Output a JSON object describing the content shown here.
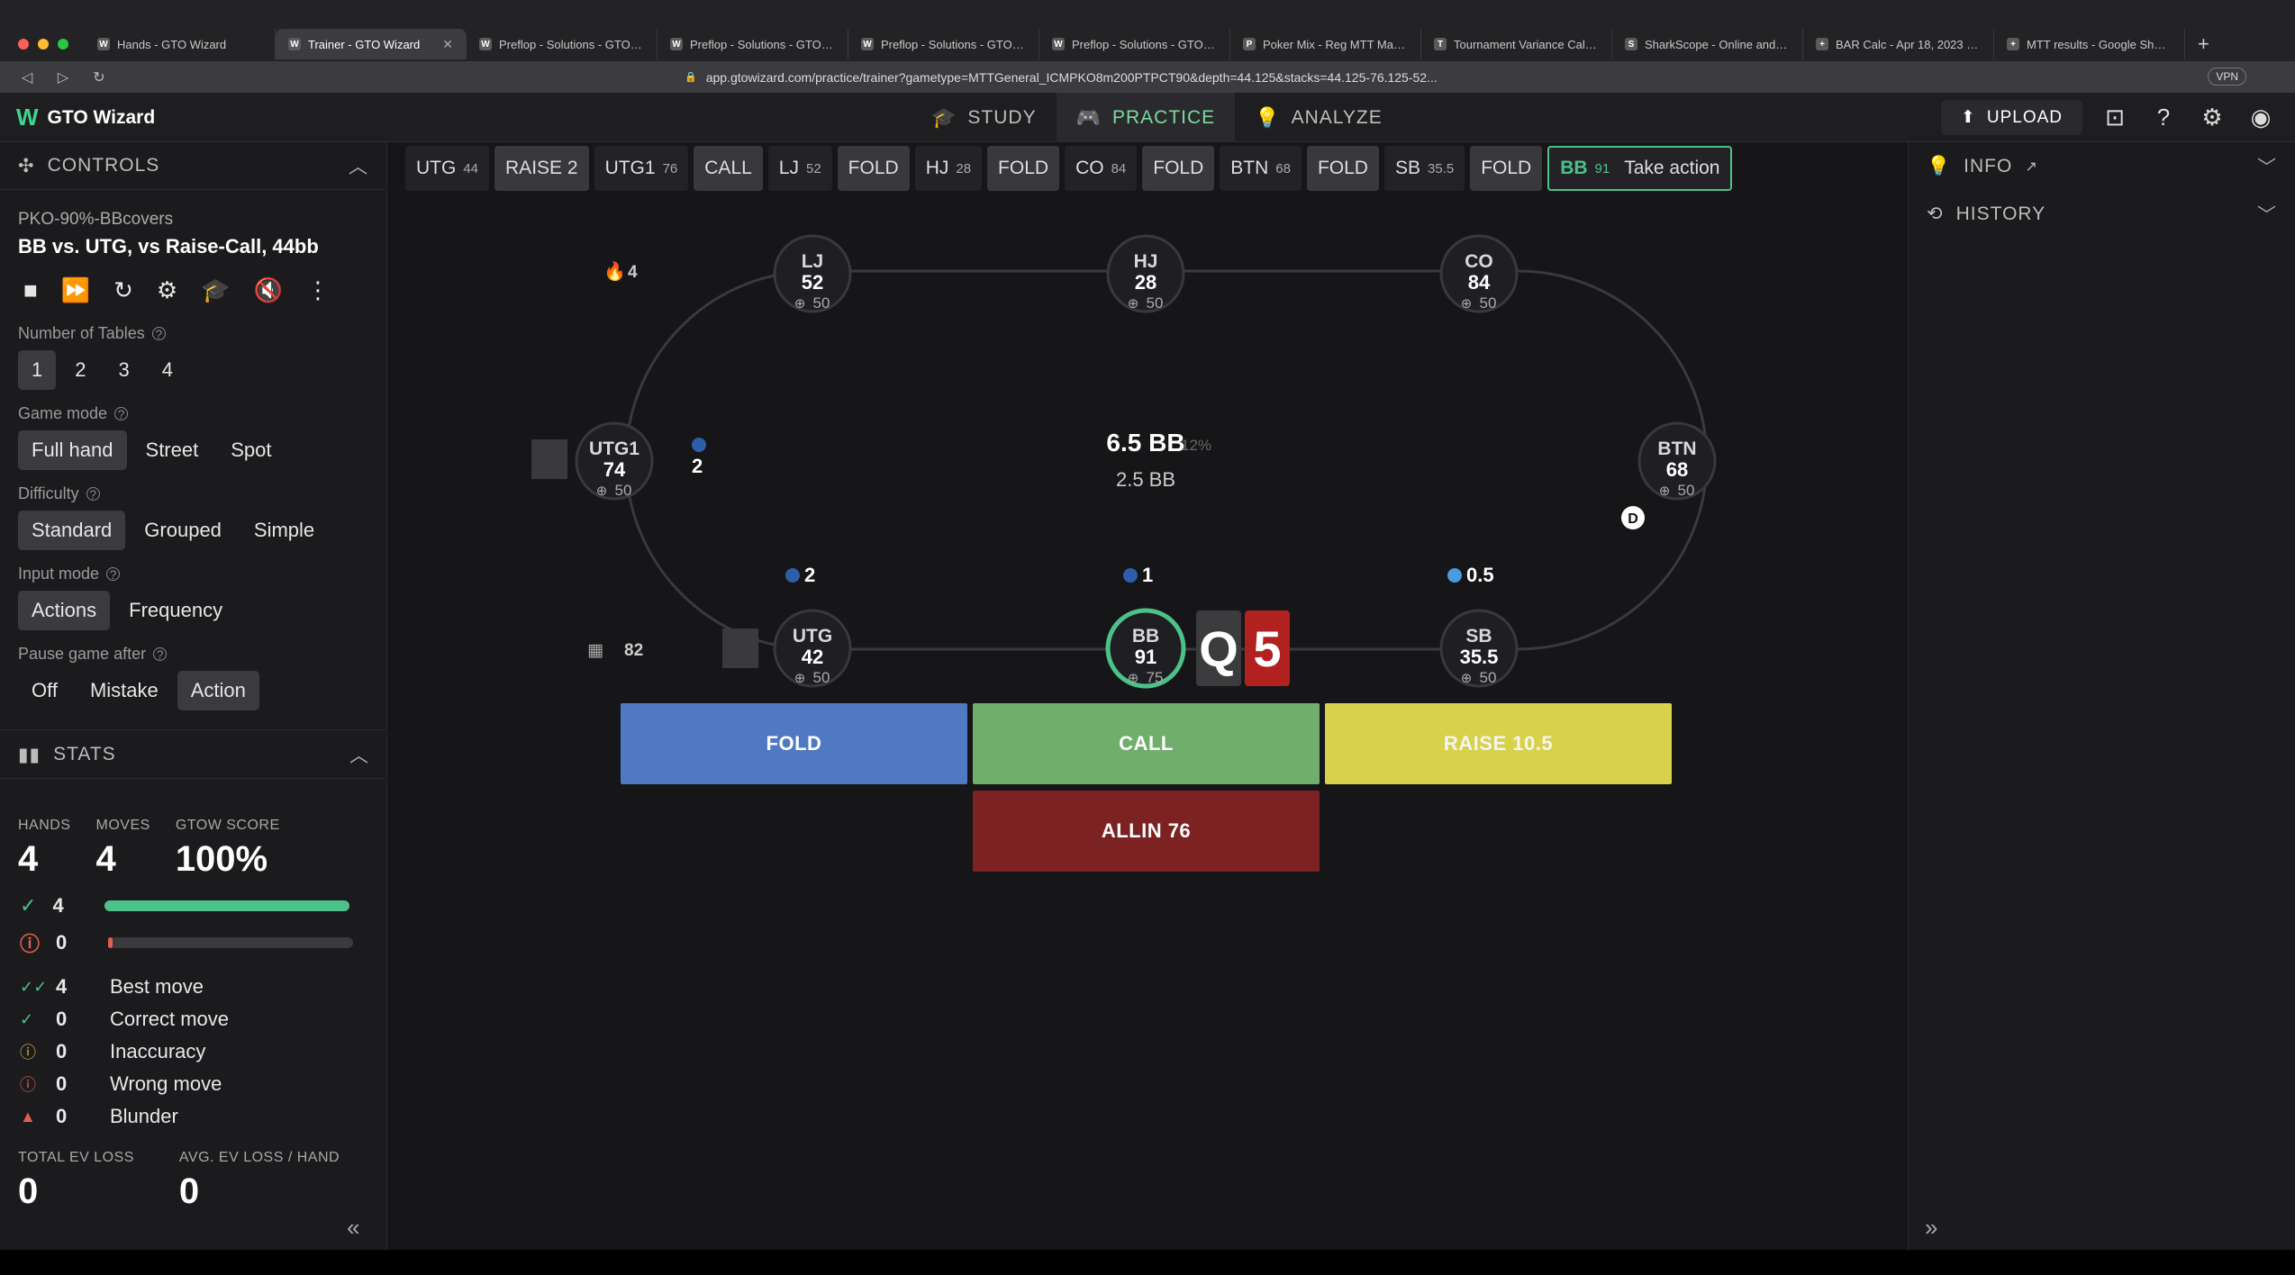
{
  "browser": {
    "tabs": [
      {
        "label": "Hands - GTO Wizard",
        "icon": "W"
      },
      {
        "label": "Trainer - GTO Wizard",
        "icon": "W",
        "active": true
      },
      {
        "label": "Preflop - Solutions - GTO Wi...",
        "icon": "W"
      },
      {
        "label": "Preflop - Solutions - GTO Wi...",
        "icon": "W"
      },
      {
        "label": "Preflop - Solutions - GTO Wi...",
        "icon": "W"
      },
      {
        "label": "Preflop - Solutions - GTO Wi...",
        "icon": "W"
      },
      {
        "label": "Poker Mix - Reg MTT Map, O...",
        "icon": "P"
      },
      {
        "label": "Tournament Variance Calcula...",
        "icon": "T"
      },
      {
        "label": "SharkScope - Online and Live...",
        "icon": "S"
      },
      {
        "label": "BAR Calc - Apr 18, 2023 - Go...",
        "icon": "+"
      },
      {
        "label": "MTT results - Google Sheets",
        "icon": "+"
      }
    ],
    "url": "app.gtowizard.com/practice/trainer?gametype=MTTGeneral_ICMPKO8m200PTPCT90&depth=44.125&stacks=44.125-76.125-52...",
    "vpn": "VPN"
  },
  "app": {
    "logo": "GTO Wizard",
    "nav": {
      "study": "STUDY",
      "practice": "PRACTICE",
      "analyze": "ANALYZE"
    },
    "upload": "UPLOAD"
  },
  "controls": {
    "header": "CONTROLS",
    "sub": "PKO-90%-BBcovers",
    "title": "BB vs. UTG, vs Raise-Call, 44bb",
    "tables_label": "Number of Tables",
    "tables": [
      "1",
      "2",
      "3",
      "4"
    ],
    "game_mode_label": "Game mode",
    "game_modes": [
      "Full hand",
      "Street",
      "Spot"
    ],
    "difficulty_label": "Difficulty",
    "difficulties": [
      "Standard",
      "Grouped",
      "Simple"
    ],
    "input_mode_label": "Input mode",
    "input_modes": [
      "Actions",
      "Frequency"
    ],
    "pause_label": "Pause game after",
    "pause_modes": [
      "Off",
      "Mistake",
      "Action"
    ]
  },
  "stats": {
    "header": "STATS",
    "hands_label": "HANDS",
    "hands": "4",
    "moves_label": "MOVES",
    "moves": "4",
    "score_label": "GTOW SCORE",
    "score": "100%",
    "correct_count": "4",
    "correct_fraction": 1.0,
    "wrong_count": "0",
    "wrong_fraction": 0.0,
    "moves_list": [
      {
        "n": "4",
        "label": "Best move",
        "color": "#4cc28a"
      },
      {
        "n": "0",
        "label": "Correct move",
        "color": "#4cc28a"
      },
      {
        "n": "0",
        "label": "Inaccuracy",
        "color": "#e2b33c"
      },
      {
        "n": "0",
        "label": "Wrong move",
        "color": "#e0604f"
      },
      {
        "n": "0",
        "label": "Blunder",
        "color": "#e0604f"
      }
    ],
    "total_ev_label": "TOTAL EV LOSS",
    "total_ev": "0",
    "avg_ev_label": "AVG. EV LOSS / HAND",
    "avg_ev": "0"
  },
  "action_bar": [
    {
      "pos": "UTG",
      "stack": "44",
      "action": "RAISE 2"
    },
    {
      "pos": "UTG1",
      "stack": "76",
      "action": "CALL"
    },
    {
      "pos": "LJ",
      "stack": "52",
      "action": "FOLD"
    },
    {
      "pos": "HJ",
      "stack": "28",
      "action": "FOLD"
    },
    {
      "pos": "CO",
      "stack": "84",
      "action": "FOLD"
    },
    {
      "pos": "BTN",
      "stack": "68",
      "action": "FOLD"
    },
    {
      "pos": "SB",
      "stack": "35.5",
      "action": "FOLD"
    }
  ],
  "current": {
    "pos": "BB",
    "stack": "91",
    "label": "Take action"
  },
  "table": {
    "fire_count": "4",
    "pot": "6.5 BB",
    "pot_pct": "12%",
    "pot_sub": "2.5 BB",
    "dealer": "D",
    "tables_count": "82",
    "seats": {
      "lj": {
        "name": "LJ",
        "stack": "52",
        "bounty": "50"
      },
      "hj": {
        "name": "HJ",
        "stack": "28",
        "bounty": "50"
      },
      "co": {
        "name": "CO",
        "stack": "84",
        "bounty": "50"
      },
      "utg1": {
        "name": "UTG1",
        "stack": "74",
        "bounty": "50"
      },
      "btn": {
        "name": "BTN",
        "stack": "68",
        "bounty": "50"
      },
      "utg": {
        "name": "UTG",
        "stack": "42",
        "bounty": "50"
      },
      "bb": {
        "name": "BB",
        "stack": "91",
        "bounty": "75"
      },
      "sb": {
        "name": "SB",
        "stack": "35.5",
        "bounty": "50"
      }
    },
    "bets": {
      "utg1": "2",
      "utg": "2",
      "bb": "1",
      "sb": "0.5"
    },
    "cards": [
      {
        "rank": "Q",
        "color": "#3c3c3f"
      },
      {
        "rank": "5",
        "color": "#b0211f"
      }
    ]
  },
  "actions": {
    "fold": "FOLD",
    "call": "CALL",
    "raise": "RAISE 10.5",
    "allin": "ALLIN 76"
  },
  "right": {
    "info": "INFO",
    "history": "HISTORY"
  }
}
